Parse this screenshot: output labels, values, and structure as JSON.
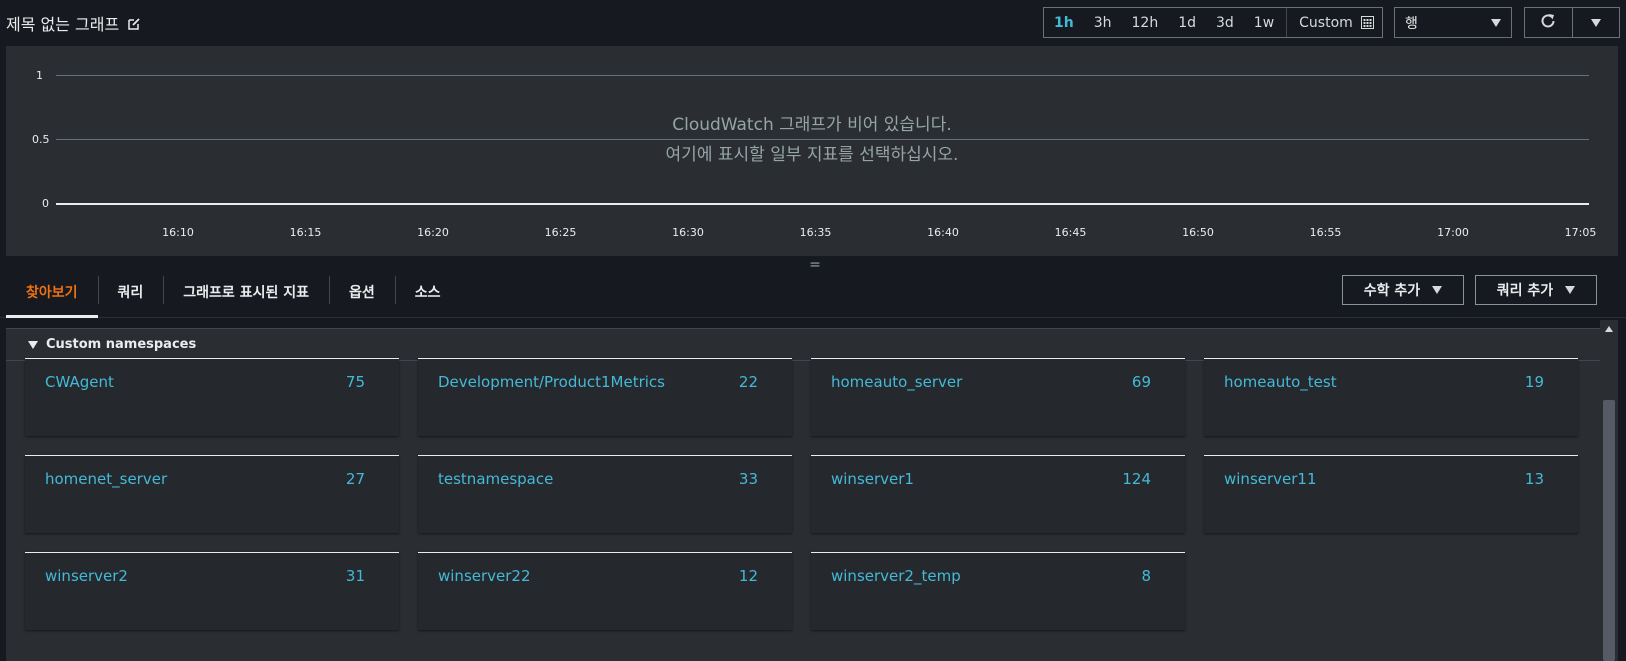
{
  "header": {
    "title": "제목 없는 그래프",
    "time_ranges": [
      "1h",
      "3h",
      "12h",
      "1d",
      "3d",
      "1w"
    ],
    "active_time_range": "1h",
    "custom_label": "Custom",
    "view_select": "행"
  },
  "graph": {
    "empty_line1": "CloudWatch 그래프가 비어 있습니다.",
    "empty_line2": "여기에 표시할 일부 지표를 선택하십시오.",
    "y_ticks": [
      "1",
      "0.5",
      "0"
    ],
    "x_ticks": [
      "16:10",
      "16:15",
      "16:20",
      "16:25",
      "16:30",
      "16:35",
      "16:40",
      "16:45",
      "16:50",
      "16:55",
      "17:00",
      "17:05"
    ]
  },
  "resize_handle": "=",
  "tabs": [
    {
      "label": "찾아보기",
      "active": true
    },
    {
      "label": "쿼리",
      "active": false
    },
    {
      "label": "그래프로 표시된 지표",
      "active": false
    },
    {
      "label": "옵션",
      "active": false
    },
    {
      "label": "소스",
      "active": false
    }
  ],
  "actions": {
    "add_math": "수학 추가",
    "add_query": "쿼리 추가"
  },
  "browse": {
    "section_title": "Custom namespaces",
    "namespaces": [
      {
        "name": "CWAgent",
        "count": "75"
      },
      {
        "name": "Development/Product1Metrics",
        "count": "22"
      },
      {
        "name": "homeauto_server",
        "count": "69"
      },
      {
        "name": "homeauto_test",
        "count": "19"
      },
      {
        "name": "homenet_server",
        "count": "27"
      },
      {
        "name": "testnamespace",
        "count": "33"
      },
      {
        "name": "winserver1",
        "count": "124"
      },
      {
        "name": "winserver11",
        "count": "13"
      },
      {
        "name": "winserver2",
        "count": "31"
      },
      {
        "name": "winserver22",
        "count": "12"
      },
      {
        "name": "winserver2_temp",
        "count": "8"
      }
    ]
  },
  "colors": {
    "accent_link": "#44b9d6",
    "active_tab": "#ec7211",
    "background": "#16191f",
    "panel": "#2a2e33"
  }
}
